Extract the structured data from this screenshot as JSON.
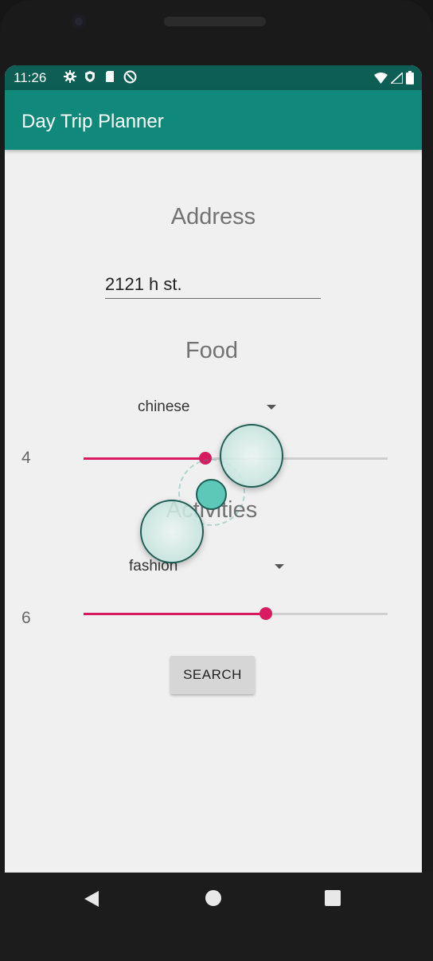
{
  "status_bar": {
    "time": "11:26",
    "left_icons": [
      "gear-icon",
      "shield-icon",
      "sd-card-icon",
      "at-sign-icon"
    ],
    "right_icons": [
      "wifi-icon",
      "signal-icon",
      "battery-icon"
    ]
  },
  "app_bar": {
    "title": "Day Trip Planner"
  },
  "address": {
    "label": "Address",
    "value": "2121 h st."
  },
  "food": {
    "label": "Food",
    "selected": "chinese",
    "slider_value": "4",
    "slider_fraction": 0.4
  },
  "activities": {
    "label": "Activities",
    "selected": "fashion",
    "slider_value": "6",
    "slider_fraction": 0.6
  },
  "search_button": {
    "label": "SEARCH"
  },
  "colors": {
    "status_bar": "#0d5f55",
    "app_bar": "#10897a",
    "accent": "#d81b60",
    "background": "#f0f0f0"
  },
  "nav_bar": {
    "icons": [
      "back-icon",
      "home-icon",
      "recents-icon"
    ]
  }
}
